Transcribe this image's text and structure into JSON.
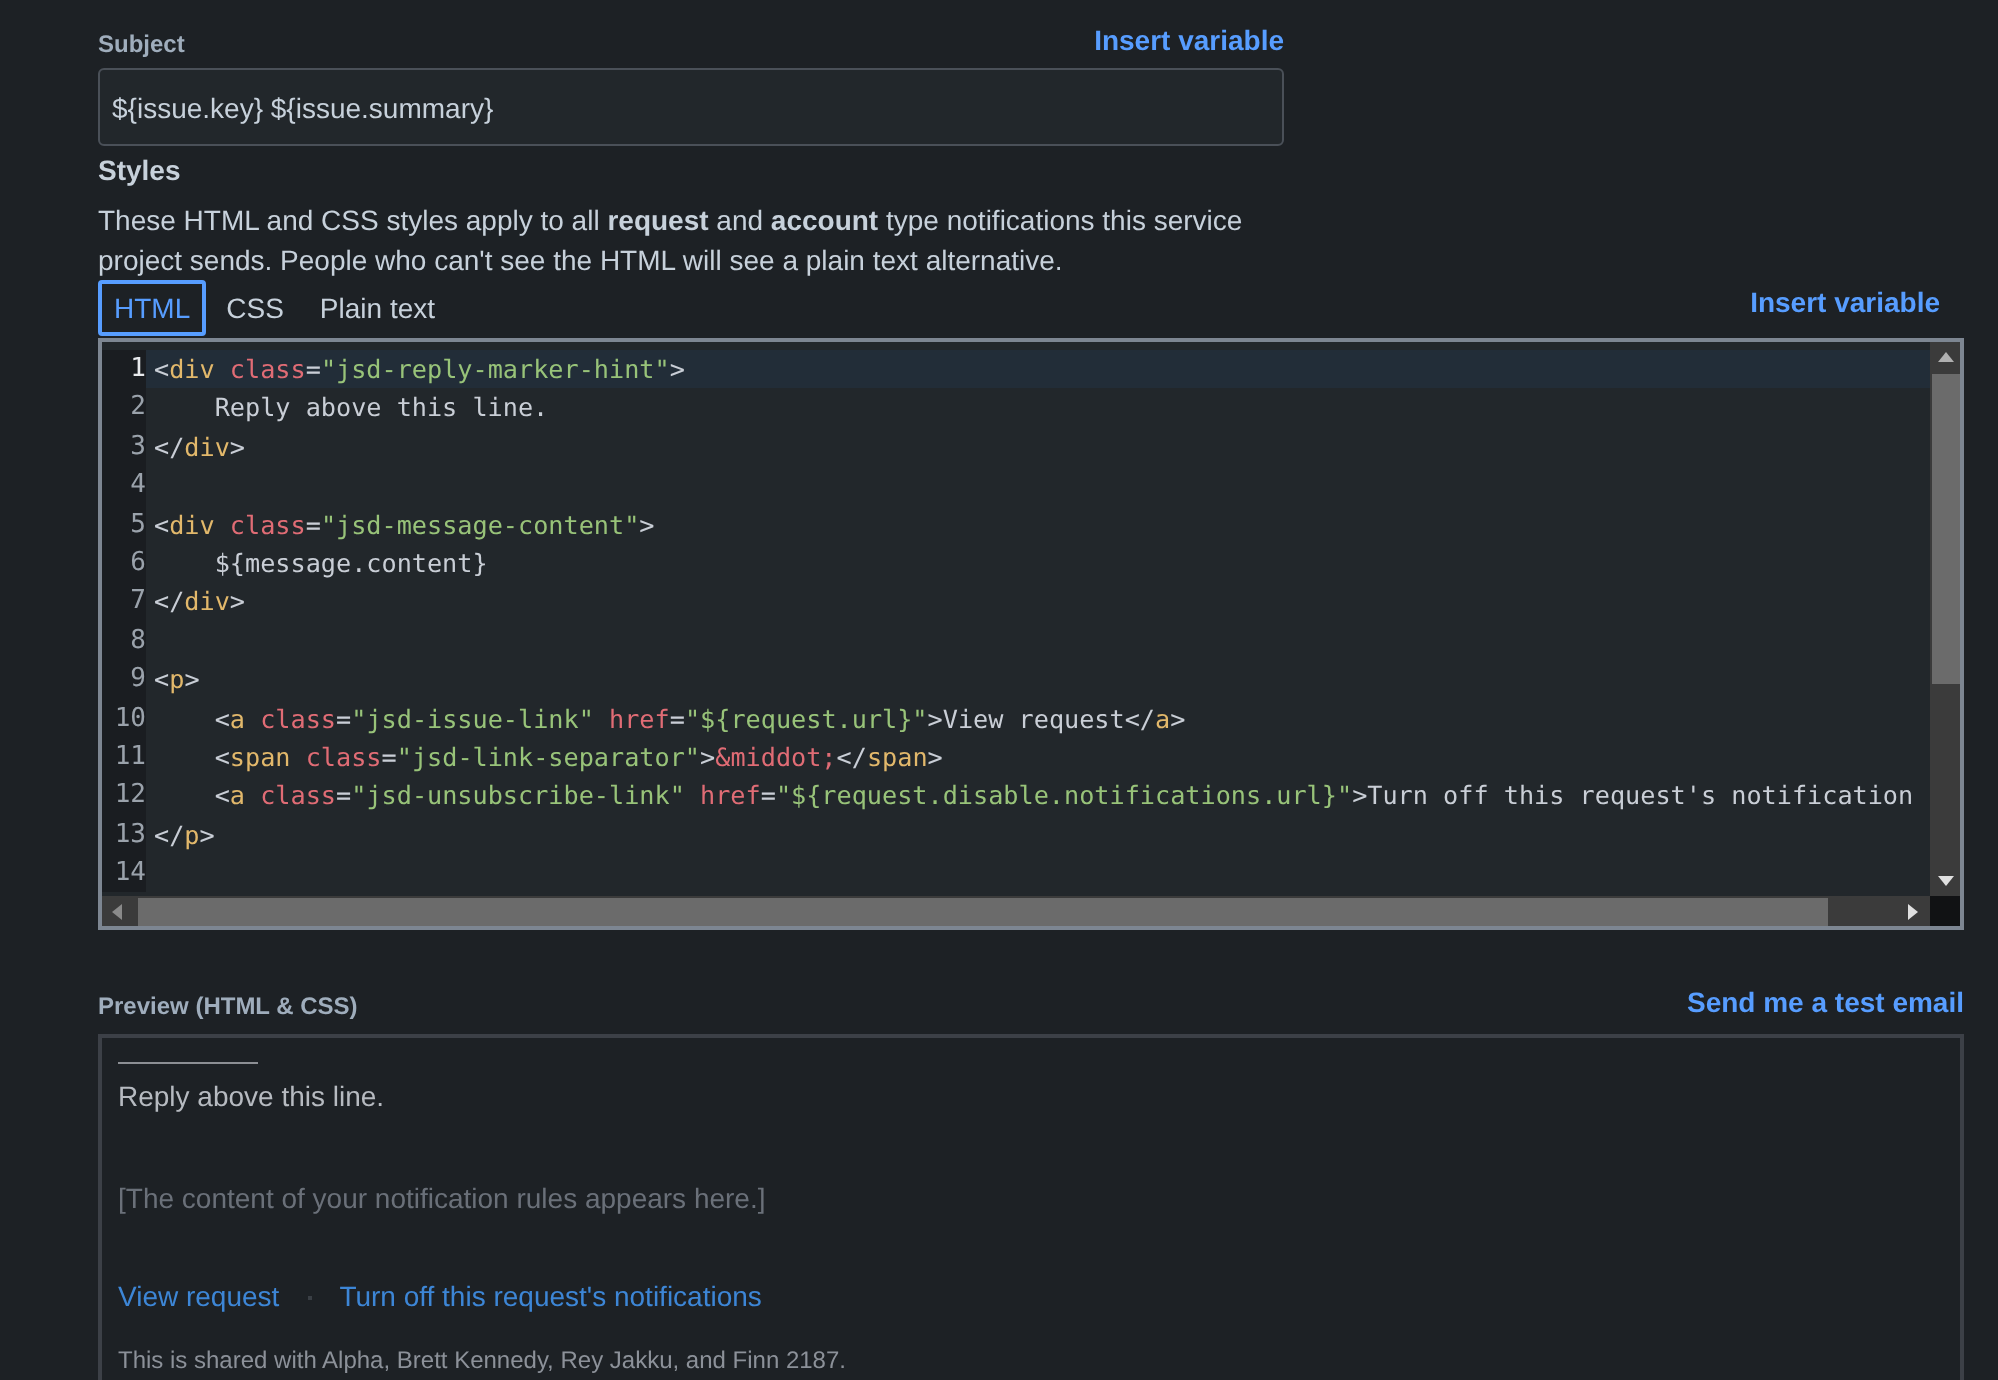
{
  "subject": {
    "label": "Subject",
    "insert_link": "Insert variable",
    "value": "${issue.key} ${issue.summary}"
  },
  "styles": {
    "heading": "Styles",
    "description": "These HTML and CSS styles apply to all **request** and **account** type notifications this service project sends. People who can't see the HTML will see a plain text alternative.",
    "tabs": [
      {
        "label": "HTML",
        "selected": true
      },
      {
        "label": "CSS",
        "selected": false
      },
      {
        "label": "Plain text",
        "selected": false
      }
    ],
    "insert_link": "Insert variable"
  },
  "editor": {
    "lines": [
      {
        "number": "1",
        "active": true,
        "tokens": [
          {
            "kind": "punct",
            "text": "<"
          },
          {
            "kind": "tag",
            "text": "div"
          },
          {
            "kind": "attr",
            "text": " class"
          },
          {
            "kind": "punct",
            "text": "="
          },
          {
            "kind": "string",
            "text": "\"jsd-reply-marker-hint\""
          },
          {
            "kind": "punct",
            "text": ">"
          }
        ]
      },
      {
        "number": "2",
        "active": false,
        "tokens": [
          {
            "kind": "text",
            "text": "    Reply above this line."
          }
        ]
      },
      {
        "number": "3",
        "active": false,
        "tokens": [
          {
            "kind": "punct",
            "text": "</"
          },
          {
            "kind": "tag",
            "text": "div"
          },
          {
            "kind": "punct",
            "text": ">"
          }
        ]
      },
      {
        "number": "4",
        "active": false
      },
      {
        "number": "5",
        "active": false,
        "tokens": [
          {
            "kind": "punct",
            "text": "<"
          },
          {
            "kind": "tag",
            "text": "div"
          },
          {
            "kind": "attr",
            "text": " class"
          },
          {
            "kind": "punct",
            "text": "="
          },
          {
            "kind": "string",
            "text": "\"jsd-message-content\""
          },
          {
            "kind": "punct",
            "text": ">"
          }
        ]
      },
      {
        "number": "6",
        "active": false,
        "tokens": [
          {
            "kind": "text",
            "text": "    ${message.content}"
          }
        ]
      },
      {
        "number": "7",
        "active": false,
        "tokens": [
          {
            "kind": "punct",
            "text": "</"
          },
          {
            "kind": "tag",
            "text": "div"
          },
          {
            "kind": "punct",
            "text": ">"
          }
        ]
      },
      {
        "number": "8",
        "active": false
      },
      {
        "number": "9",
        "active": false,
        "tokens": [
          {
            "kind": "punct",
            "text": "<"
          },
          {
            "kind": "tag",
            "text": "p"
          },
          {
            "kind": "punct",
            "text": ">"
          }
        ]
      },
      {
        "number": "10",
        "active": false,
        "tokens": [
          {
            "kind": "punct",
            "text": "    <"
          },
          {
            "kind": "tag",
            "text": "a"
          },
          {
            "kind": "attr",
            "text": " class"
          },
          {
            "kind": "punct",
            "text": "="
          },
          {
            "kind": "string",
            "text": "\"jsd-issue-link\""
          },
          {
            "kind": "attr",
            "text": " href"
          },
          {
            "kind": "punct",
            "text": "="
          },
          {
            "kind": "string",
            "text": "\"${request.url}\""
          },
          {
            "kind": "text",
            "text": ">View request</"
          },
          {
            "kind": "tag",
            "text": "a"
          },
          {
            "kind": "punct",
            "text": ">"
          }
        ]
      },
      {
        "number": "11",
        "active": false,
        "tokens": [
          {
            "kind": "punct",
            "text": "    <"
          },
          {
            "kind": "tag",
            "text": "span"
          },
          {
            "kind": "attr",
            "text": " class"
          },
          {
            "kind": "punct",
            "text": "="
          },
          {
            "kind": "string",
            "text": "\"jsd-link-separator\""
          },
          {
            "kind": "punct",
            "text": ">"
          },
          {
            "kind": "attr",
            "text": "&middot;"
          },
          {
            "kind": "punct",
            "text": "</"
          },
          {
            "kind": "tag",
            "text": "span"
          },
          {
            "kind": "punct",
            "text": ">"
          }
        ]
      },
      {
        "number": "12",
        "active": false,
        "tokens": [
          {
            "kind": "punct",
            "text": "    <"
          },
          {
            "kind": "tag",
            "text": "a"
          },
          {
            "kind": "attr",
            "text": " class"
          },
          {
            "kind": "punct",
            "text": "="
          },
          {
            "kind": "string",
            "text": "\"jsd-unsubscribe-link\""
          },
          {
            "kind": "attr",
            "text": " href"
          },
          {
            "kind": "punct",
            "text": "="
          },
          {
            "kind": "string",
            "text": "\"${request.disable.notifications.url}\""
          },
          {
            "kind": "text",
            "text": ">Turn off this request's notification"
          }
        ]
      },
      {
        "number": "13",
        "active": false,
        "tokens": [
          {
            "kind": "punct",
            "text": "</"
          },
          {
            "kind": "tag",
            "text": "p"
          },
          {
            "kind": "punct",
            "text": ">"
          }
        ]
      },
      {
        "number": "14",
        "active": false
      }
    ]
  },
  "preview": {
    "label": "Preview (HTML & CSS)",
    "test_link": "Send me a test email",
    "reply_hint": "Reply above this line.",
    "placeholder_content": "[The content of your notification rules appears here.]",
    "links": [
      "View request",
      "Turn off this request's notifications"
    ],
    "shared_note": "This is shared with Alpha, Brett Kennedy, Rey Jakku, and Finn 2187."
  }
}
